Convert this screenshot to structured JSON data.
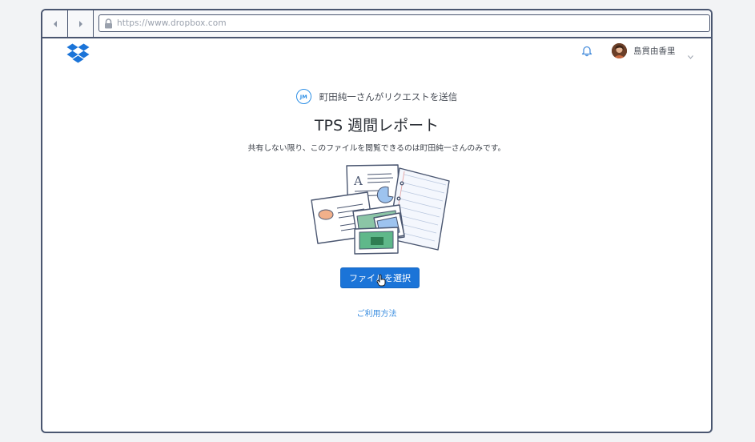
{
  "browser": {
    "back_icon": "chevron-left-icon",
    "forward_icon": "chevron-right-icon",
    "lock_icon": "lock-icon",
    "url": "https://www.dropbox.com"
  },
  "header": {
    "logo_icon": "dropbox-logo-icon",
    "notification_icon": "bell-icon",
    "user_name": "島貫由香里",
    "user_menu_icon": "chevron-down-icon"
  },
  "request": {
    "requester_initials": "JM",
    "requester_text": "町田純一さんがリクエストを送信",
    "title": "TPS 週間レポート",
    "subtitle": "共有しない限り、このファイルを閲覧できるのは町田純一さんのみです。",
    "choose_button_label": "ファイルを選択",
    "help_link": "ご利用方法"
  },
  "colors": {
    "accent": "#1b74d8",
    "link": "#3d8fe0",
    "frame": "#4a5670"
  }
}
